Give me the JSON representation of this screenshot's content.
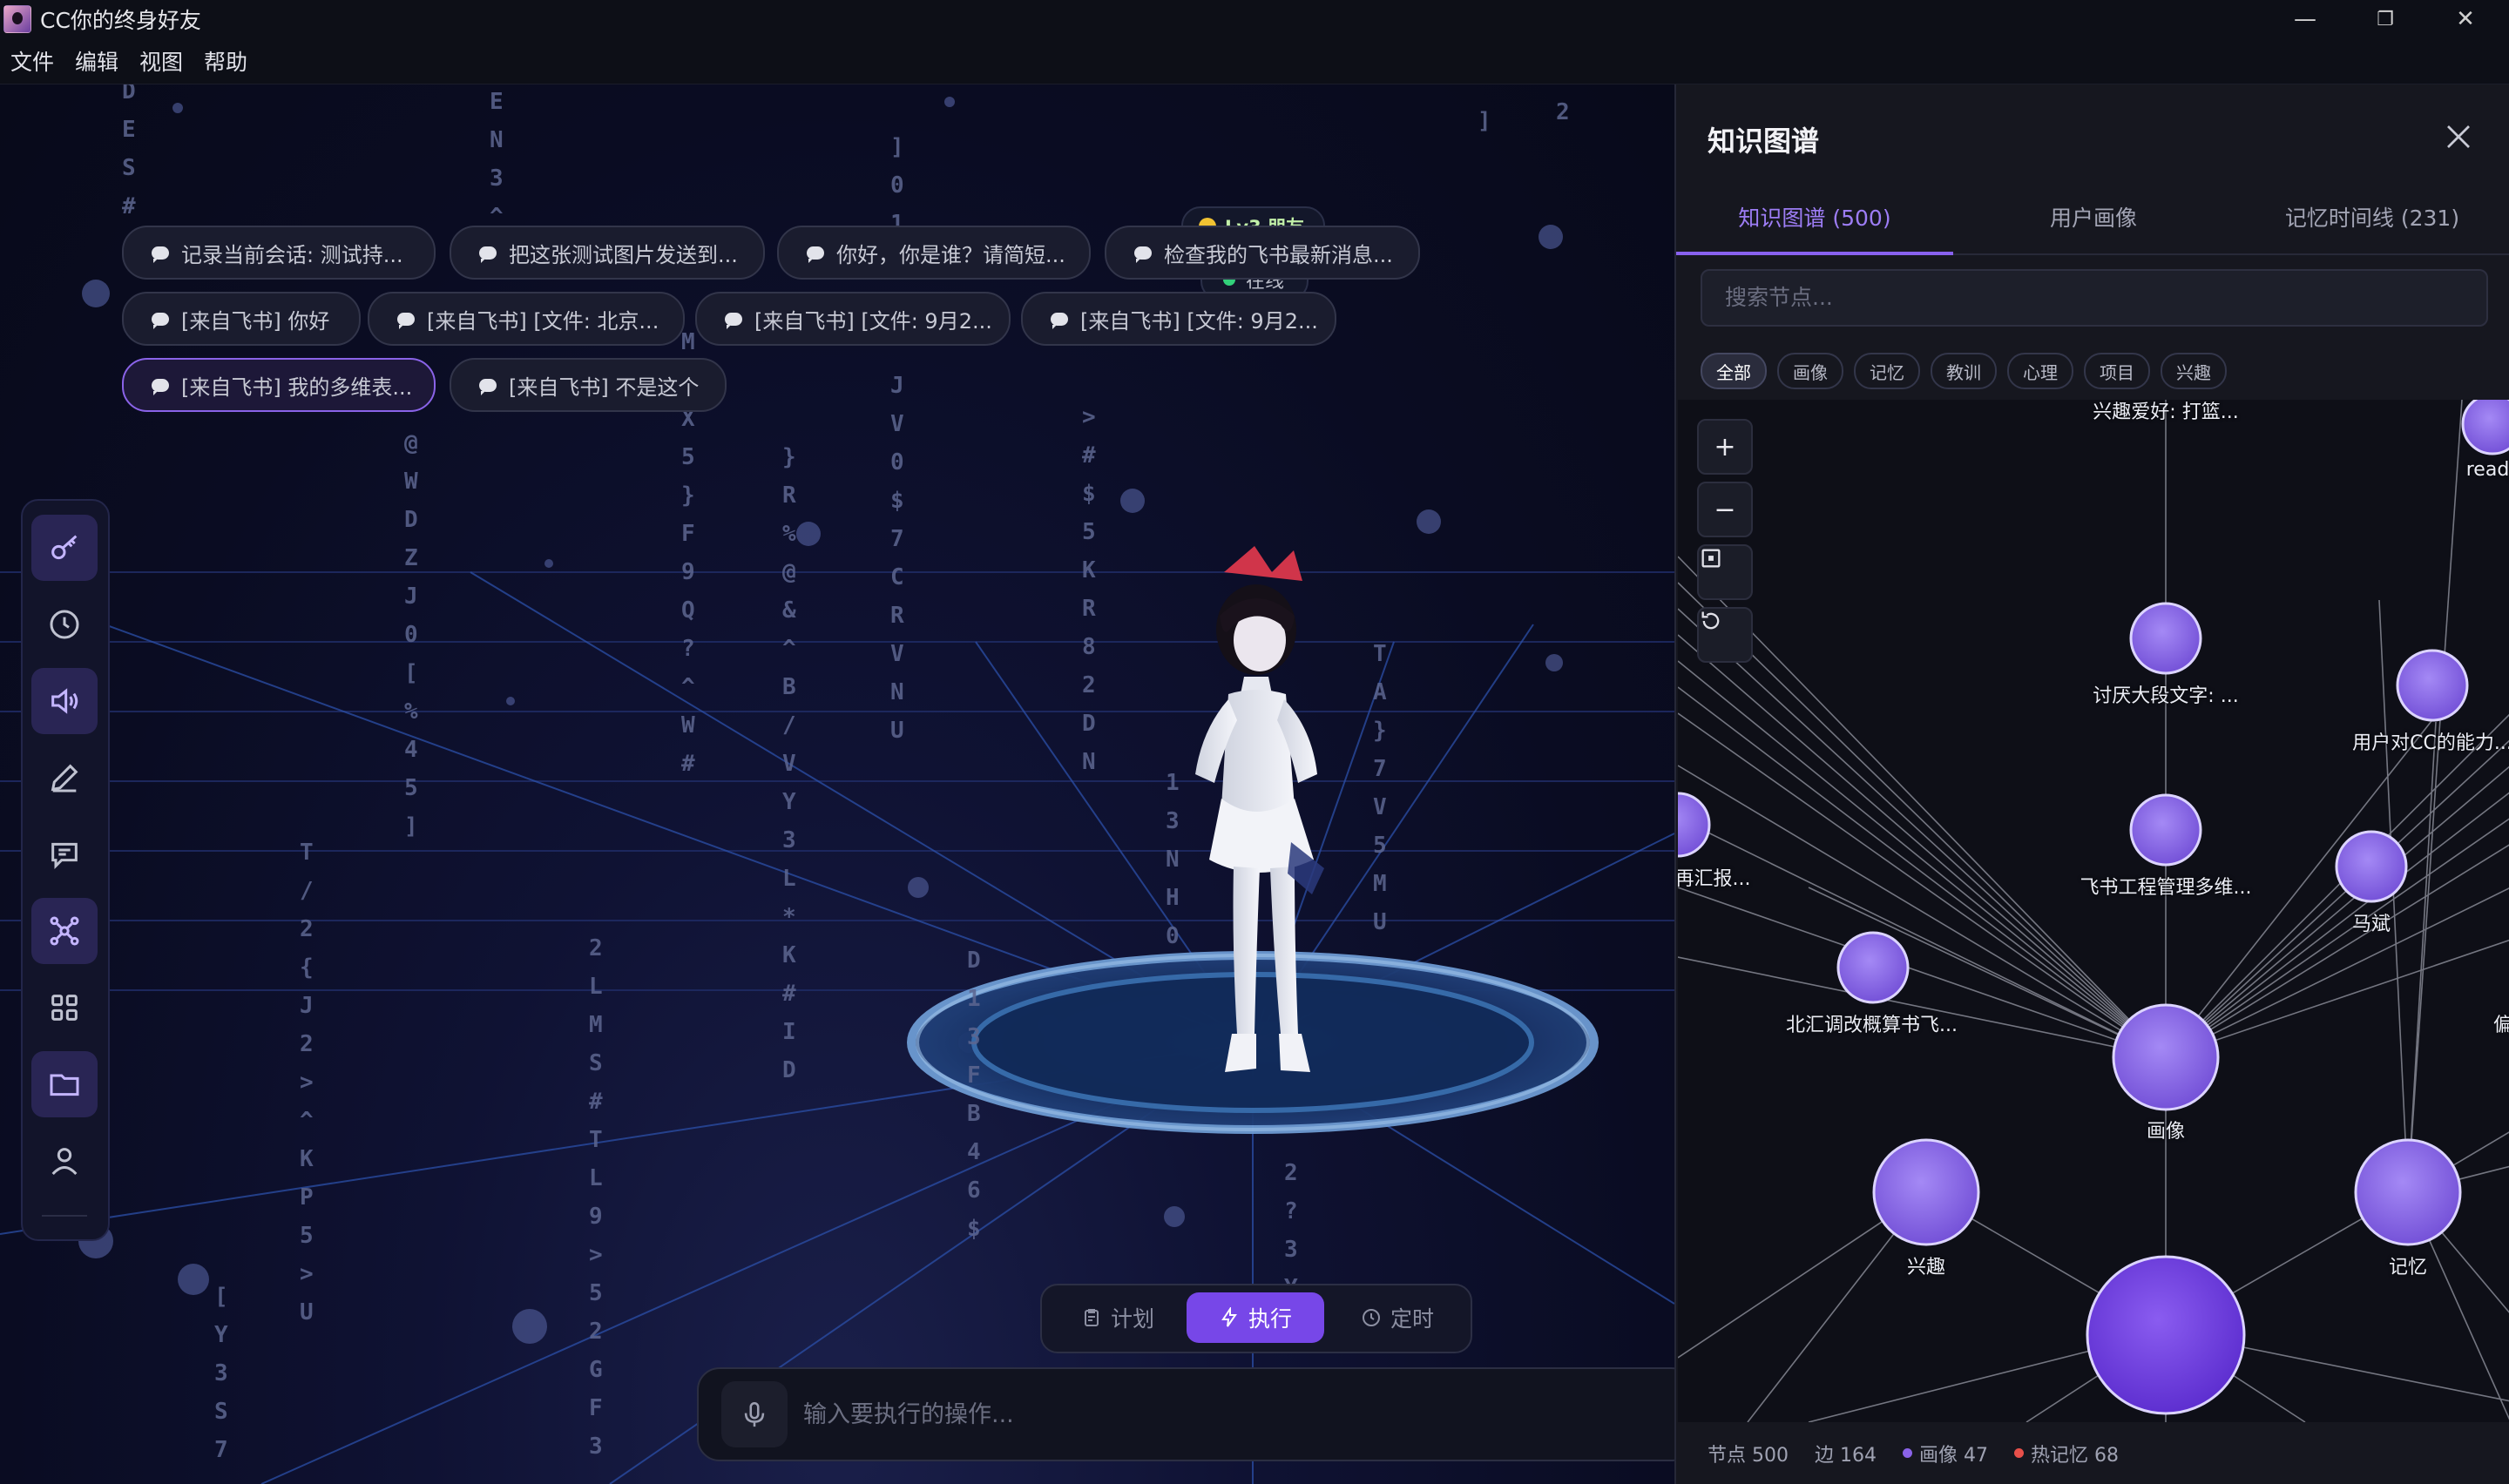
{
  "window": {
    "title": "CC你的终身好友",
    "minimize": "—",
    "maximize": "❐",
    "close": "✕"
  },
  "menu": [
    "文件",
    "编辑",
    "视图",
    "帮助"
  ],
  "status": {
    "level": "Lv3 朋友",
    "online": "在线"
  },
  "quick_chips": [
    "记录当前会话: 测试持...",
    "把这张测试图片发送到...",
    "你好，你是谁？请简短...",
    "检查我的飞书最新消息...",
    "[来自飞书] 你好",
    "[来自飞书] [文件: 北京...",
    "[来自飞书] [文件: 9月2...",
    "[来自飞书] [文件: 9月2...",
    "[来自飞书] 我的多维表...",
    "[来自飞书] 不是这个"
  ],
  "toolbar": [
    "key-icon",
    "clock-icon",
    "speaker-icon",
    "pen-icon",
    "chat-icon",
    "graph-icon",
    "grid-icon",
    "folder-icon",
    "user-icon"
  ],
  "modes": {
    "plan": "计划",
    "execute": "执行",
    "schedule": "定时"
  },
  "command": {
    "placeholder": "输入要执行的操作..."
  },
  "matrix_columns": [
    "D\nE\nS\n#",
    "E\nN\n3\n^",
    "]\n0\n1",
    "]",
    "2",
    "T\n@\nW\nD\nZ\nJ\n0\n[\n%\n4\n5\n]",
    "M\nL\nX\n5\n}\nF\n9\nQ\n?\n^\nW\n#",
    "}\nR\n%\n@\n&\n^\nB\n/\nV\nY\n3\nL\n*\nK\n#\nI\nD",
    "J\nV\n0\n$\n7\nC\nR\nV\nN\nU",
    ">\n#\n$\n5\nK\nR\n8\n2\nD\nN",
    "1\n3\nN\nH\n0",
    "T\nA\n}\n7\nV\n5\nM\nU",
    "T\n/\n2\n{\nJ\n2\n>\n^\nK\nP\n5\n>\nU",
    "2\nL\nM\nS\n#\nT\nL\n9\n>\n5\n2\nG\nF\n3",
    "D\n1\n3\nF\nB\n4\n6\n$",
    "[\nY\n3\nS\n7",
    "2\n?\n3\nY"
  ],
  "panel": {
    "title": "知识图谱",
    "tabs": [
      "知识图谱 (500)",
      "用户画像",
      "记忆时间线 (231)"
    ],
    "search_placeholder": "搜索节点...",
    "filters": [
      "全部",
      "画像",
      "记忆",
      "教训",
      "心理",
      "项目",
      "兴趣"
    ],
    "graph_controls": [
      "+",
      "−"
    ],
    "nodes": [
      "兴趣爱好: 打篮...",
      "read_d",
      "讨厌大段文字: ...",
      "用户对CC的能力...",
      "再汇报...",
      "飞书工程管理多维...",
      "马斌",
      "北汇调改概算书飞...",
      "偏好",
      "画像",
      "兴趣",
      "记忆"
    ],
    "footer": {
      "nodes": "节点 500",
      "edges": "边 164",
      "portrait": "画像 47",
      "hot": "热记忆 68"
    }
  },
  "colors": {
    "accent": "#7747e8",
    "online": "#32d07a",
    "portrait_dot": "#8a63e8",
    "hot_dot": "#e8504a"
  }
}
